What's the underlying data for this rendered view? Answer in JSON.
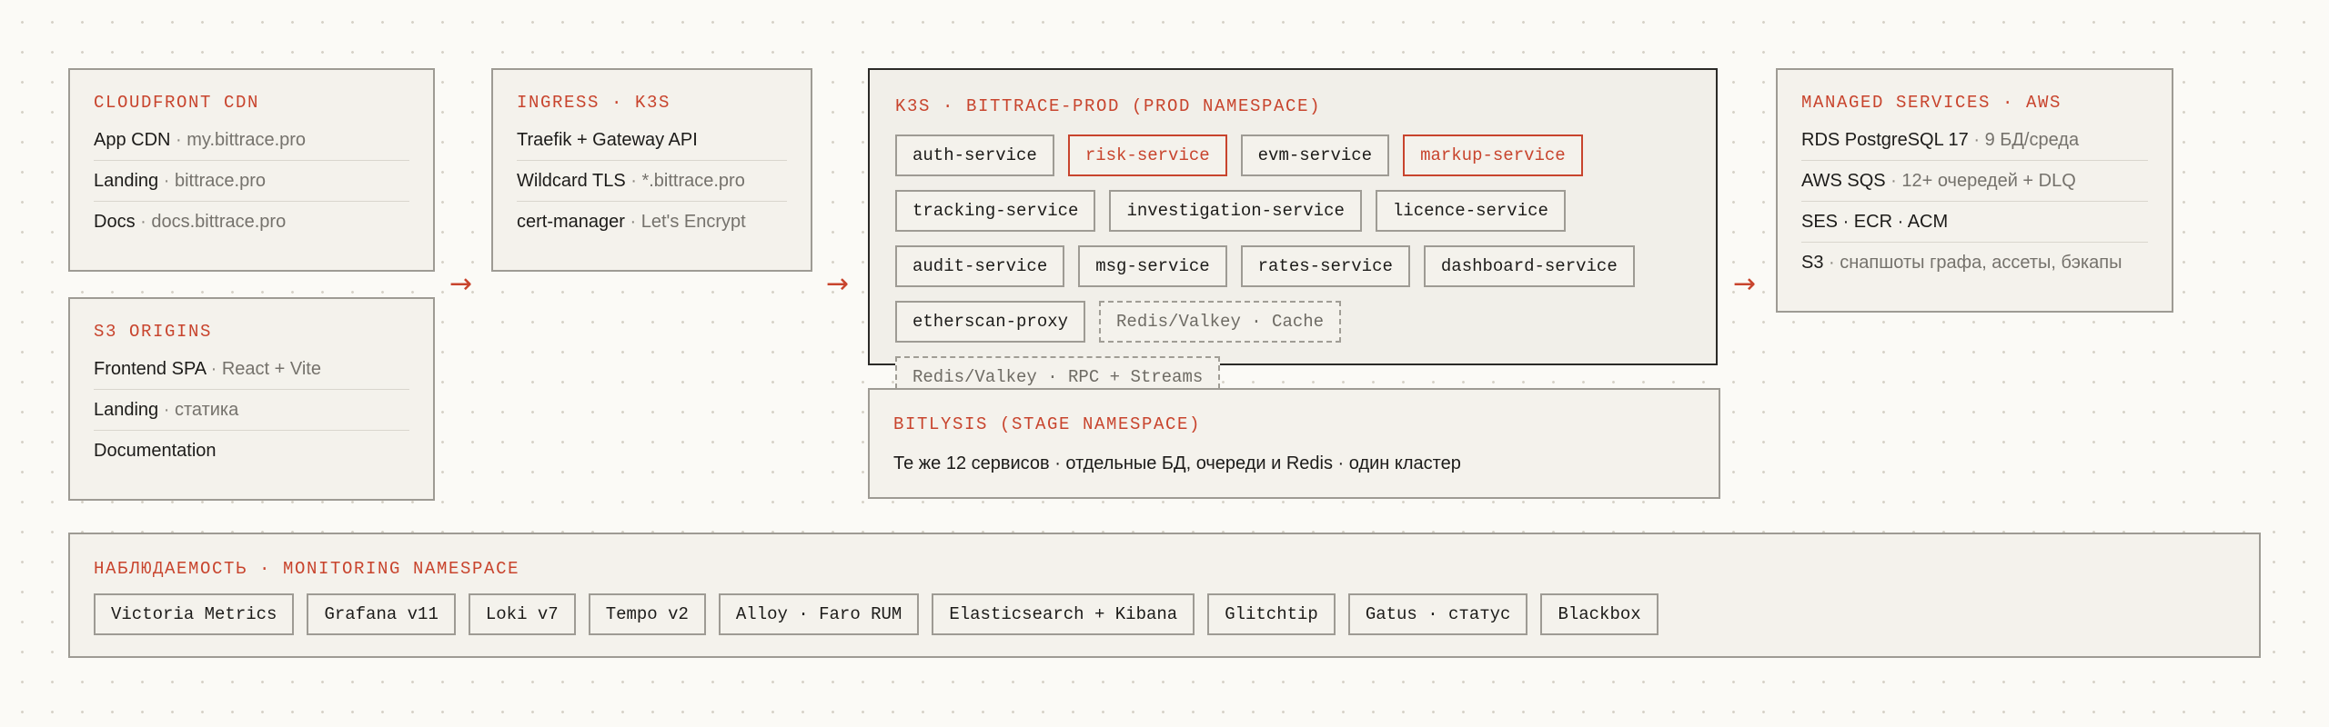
{
  "cloudfront": {
    "title": "CLOUDFRONT CDN",
    "rows": [
      {
        "main": "App CDN",
        "sub": "my.bittrace.pro"
      },
      {
        "main": "Landing",
        "sub": "bittrace.pro"
      },
      {
        "main": "Docs",
        "sub": "docs.bittrace.pro"
      }
    ]
  },
  "s3origins": {
    "title": "S3 ORIGINS",
    "rows": [
      {
        "main": "Frontend SPA",
        "sub": "React + Vite"
      },
      {
        "main": "Landing",
        "sub": "статика"
      },
      {
        "main": "Documentation",
        "sub": ""
      }
    ]
  },
  "ingress": {
    "title": "INGRESS · K3S",
    "rows": [
      {
        "main": "Traefik + Gateway API",
        "sub": ""
      },
      {
        "main": "Wildcard TLS",
        "sub": "*.bittrace.pro"
      },
      {
        "main": "cert-manager",
        "sub": "Let's Encrypt"
      }
    ]
  },
  "k3s": {
    "title": "K3S · BITTRACE-PROD (PROD NAMESPACE)",
    "chips": [
      {
        "label": "auth-service",
        "style": "normal"
      },
      {
        "label": "risk-service",
        "style": "highlight"
      },
      {
        "label": "evm-service",
        "style": "normal"
      },
      {
        "label": "markup-service",
        "style": "highlight"
      },
      {
        "label": "tracking-service",
        "style": "normal"
      },
      {
        "label": "investigation-service",
        "style": "normal"
      },
      {
        "label": "licence-service",
        "style": "normal"
      },
      {
        "label": "audit-service",
        "style": "normal"
      },
      {
        "label": "msg-service",
        "style": "normal"
      },
      {
        "label": "rates-service",
        "style": "normal"
      },
      {
        "label": "dashboard-service",
        "style": "normal"
      },
      {
        "label": "etherscan-proxy",
        "style": "normal"
      },
      {
        "label": "Redis/Valkey · Cache",
        "style": "dashed"
      },
      {
        "label": "Redis/Valkey · RPC + Streams",
        "style": "dashed"
      }
    ]
  },
  "stage": {
    "title": "BITLYSIS (STAGE NAMESPACE)",
    "text": "Те же 12 сервисов · отдельные БД, очереди и Redis · один кластер"
  },
  "managed": {
    "title": "MANAGED SERVICES · AWS",
    "rows": [
      {
        "main": "RDS PostgreSQL 17",
        "sub": "9 БД/среда"
      },
      {
        "main": "AWS SQS",
        "sub": "12+ очередей + DLQ"
      },
      {
        "main": "SES · ECR · ACM",
        "sub": ""
      },
      {
        "main": "S3",
        "sub": "снапшоты графа, ассеты, бэкапы"
      }
    ]
  },
  "monitoring": {
    "title": "НАБЛЮДАЕМОСТЬ · MONITORING NAMESPACE",
    "chips": [
      "Victoria Metrics",
      "Grafana v11",
      "Loki v7",
      "Tempo v2",
      "Alloy · Faro RUM",
      "Elasticsearch + Kibana",
      "Glitchtip",
      "Gatus · статус",
      "Blackbox"
    ]
  },
  "arrow_glyph": "→",
  "colors": {
    "accent": "#c8442d",
    "border": "#9e9b94",
    "panel": "#f4f2ec",
    "background": "#fbfaf6"
  }
}
